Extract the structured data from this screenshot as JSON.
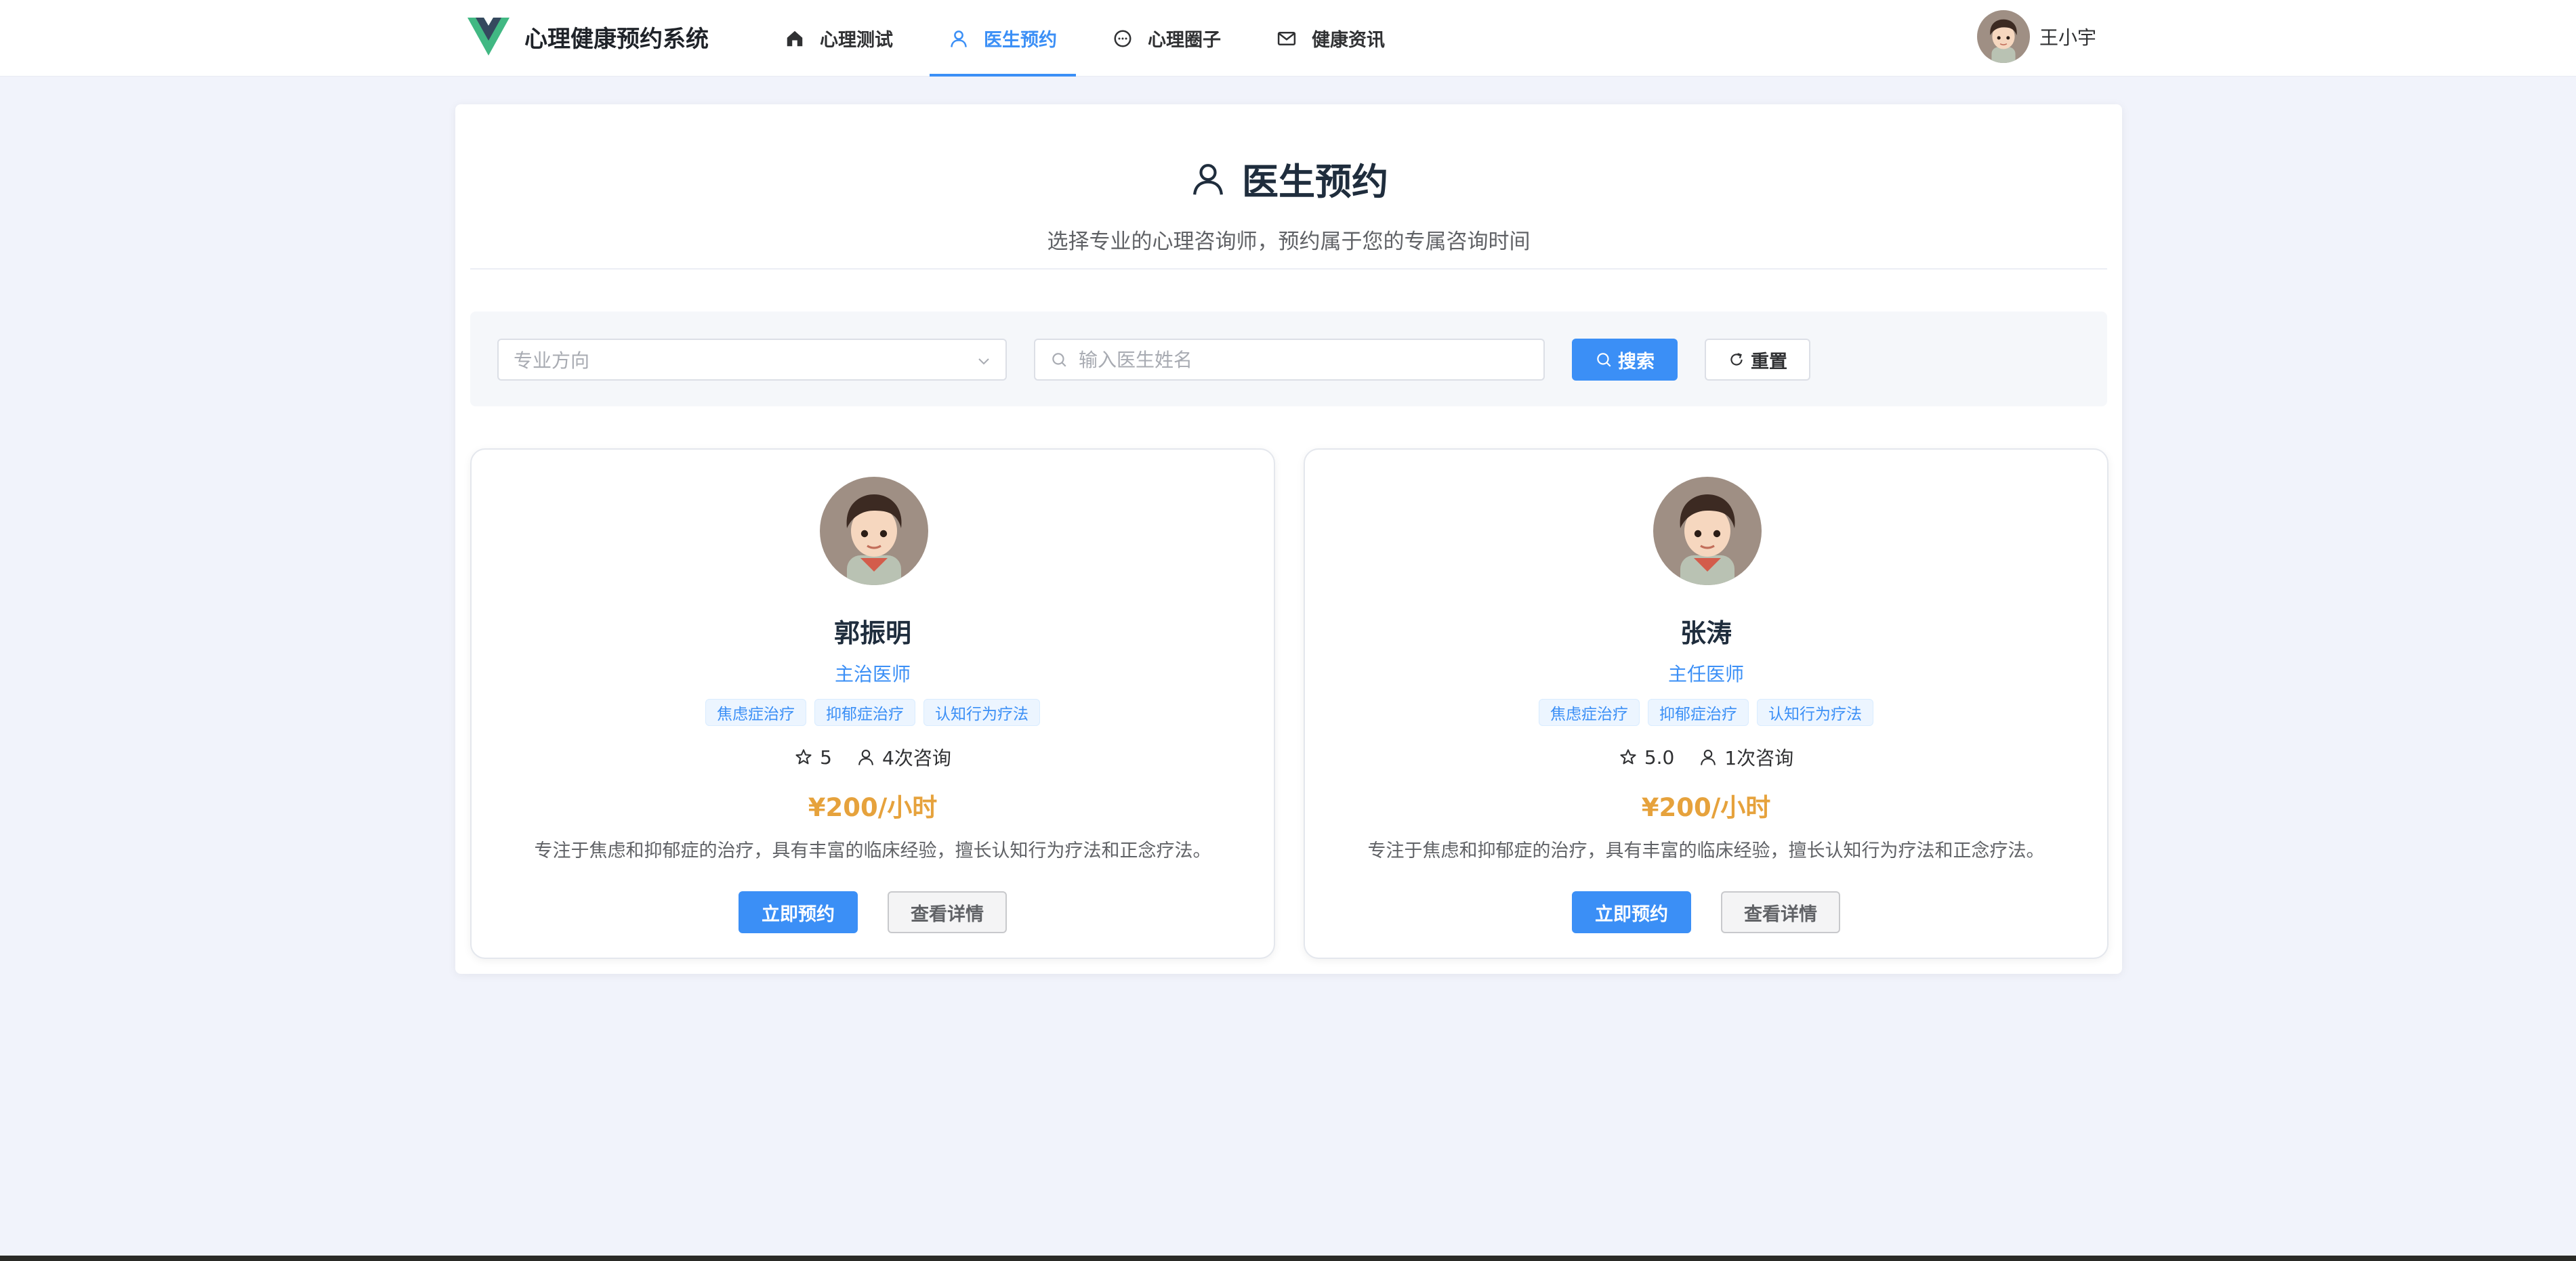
{
  "header": {
    "app_title": "心理健康预约系统",
    "nav": [
      {
        "label": "心理测试",
        "icon": "home-icon",
        "active": false
      },
      {
        "label": "医生预约",
        "icon": "user-icon",
        "active": true
      },
      {
        "label": "心理圈子",
        "icon": "chat-icon",
        "active": false
      },
      {
        "label": "健康资讯",
        "icon": "mail-icon",
        "active": false
      }
    ],
    "user_name": "王小宇"
  },
  "page": {
    "title": "医生预约",
    "subtitle": "选择专业的心理咨询师，预约属于您的专属咨询时间"
  },
  "filter": {
    "specialty_placeholder": "专业方向",
    "name_placeholder": "输入医生姓名",
    "search_label": "搜索",
    "reset_label": "重置"
  },
  "doctors": [
    {
      "name": "郭振明",
      "title": "主治医师",
      "tags": [
        "焦虑症治疗",
        "抑郁症治疗",
        "认知行为疗法"
      ],
      "rating": "5",
      "consults": "4次咨询",
      "price": "¥200/小时",
      "description": "专注于焦虑和抑郁症的治疗，具有丰富的临床经验，擅长认知行为疗法和正念疗法。",
      "book_label": "立即预约",
      "detail_label": "查看详情"
    },
    {
      "name": "张涛",
      "title": "主任医师",
      "tags": [
        "焦虑症治疗",
        "抑郁症治疗",
        "认知行为疗法"
      ],
      "rating": "5.0",
      "consults": "1次咨询",
      "price": "¥200/小时",
      "description": "专注于焦虑和抑郁症的治疗，具有丰富的临床经验，擅长认知行为疗法和正念疗法。",
      "book_label": "立即预约",
      "detail_label": "查看详情"
    }
  ],
  "colors": {
    "primary": "#3b8ff6",
    "price": "#e6a23c",
    "background": "#f1f3fb",
    "logo_green": "#41b883",
    "logo_dark": "#35495e"
  }
}
